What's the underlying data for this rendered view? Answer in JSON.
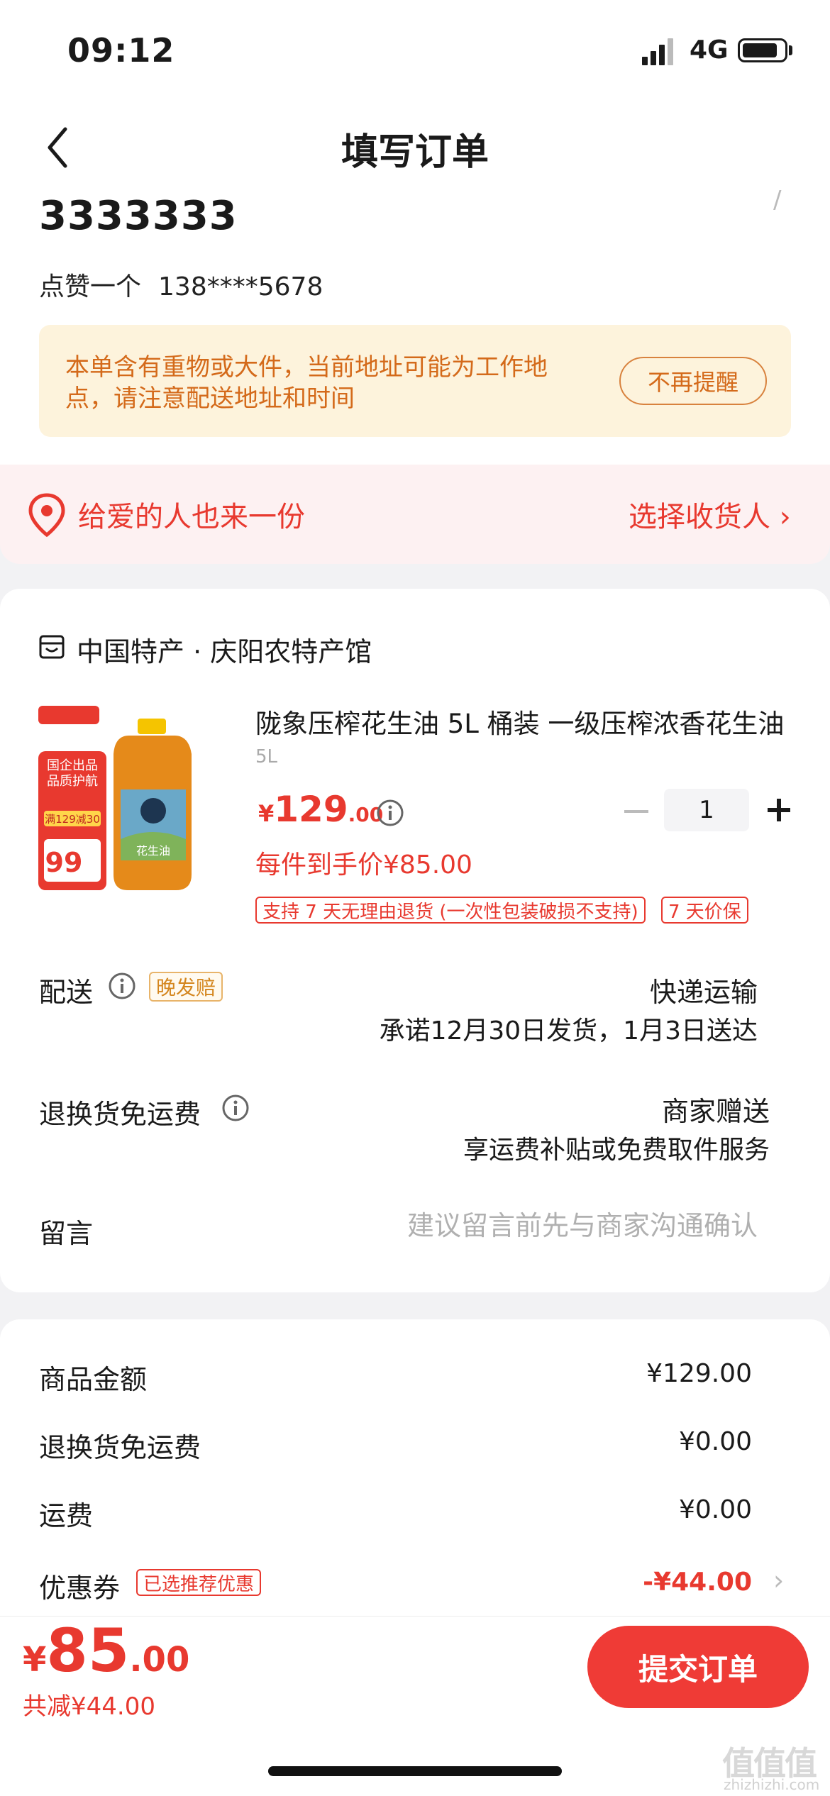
{
  "status_bar": {
    "time": "09:12",
    "network": "4G"
  },
  "nav": {
    "title": "填写订单"
  },
  "address": {
    "name": "3333333",
    "contact_name": "点赞一个",
    "phone": "138****5678",
    "notice": "本单含有重物或大件，当前地址可能为工作地点，请注意配送地址和时间",
    "notice_button": "不再提醒"
  },
  "gift": {
    "label": "给爱的人也来一份",
    "action": "选择收货人 ›"
  },
  "shop": {
    "name": "中国特产 · 庆阳农特产馆"
  },
  "product": {
    "title": "陇象压榨花生油 5L 桶装 一级压榨浓香花生油",
    "spec": "5L",
    "price_currency": "¥",
    "price_int": "129",
    "price_dec": ".00",
    "quantity": "1",
    "unit_price": "每件到手价¥85.00",
    "tags": [
      "支持 7 天无理由退货 (一次性包装破损不支持)",
      "7 天价保"
    ],
    "image_text": {
      "badge": "国企出品 品质护航",
      "promo": "满129减30",
      "bignum": "99",
      "bottle_label": "花生油"
    }
  },
  "delivery": {
    "label": "配送",
    "tag": "晚发赔",
    "value": "快递运输",
    "promise": "承诺12月30日发货，1月3日送达"
  },
  "returns": {
    "label": "退换货免运费",
    "value": "商家赠送",
    "detail": "享运费补贴或免费取件服务"
  },
  "message": {
    "label": "留言",
    "placeholder": "建议留言前先与商家沟通确认"
  },
  "summary": {
    "goods_label": "商品金额",
    "goods_value": "¥129.00",
    "returns_label": "退换货免运费",
    "returns_value": "¥0.00",
    "shipping_label": "运费",
    "shipping_value": "¥0.00",
    "coupon_label": "优惠券",
    "coupon_tag": "已选推荐优惠",
    "coupon_value": "-¥44.00"
  },
  "bottom": {
    "currency": "¥",
    "total_int": "85",
    "total_dec": ".00",
    "saved": "共减¥44.00",
    "submit": "提交订单"
  },
  "watermark": {
    "logo": "值值值",
    "site": "zhizhizhi.com"
  },
  "colors": {
    "accent": "#e8392f",
    "notice_bg": "#fdf3dc",
    "notice_text": "#d46a1a"
  }
}
